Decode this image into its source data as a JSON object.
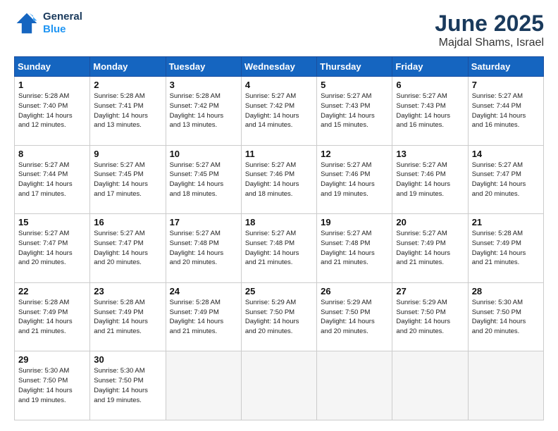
{
  "header": {
    "logo_line1": "General",
    "logo_line2": "Blue",
    "month": "June 2025",
    "location": "Majdal Shams, Israel"
  },
  "weekdays": [
    "Sunday",
    "Monday",
    "Tuesday",
    "Wednesday",
    "Thursday",
    "Friday",
    "Saturday"
  ],
  "weeks": [
    [
      {
        "day": "1",
        "info": "Sunrise: 5:28 AM\nSunset: 7:40 PM\nDaylight: 14 hours\nand 12 minutes."
      },
      {
        "day": "2",
        "info": "Sunrise: 5:28 AM\nSunset: 7:41 PM\nDaylight: 14 hours\nand 13 minutes."
      },
      {
        "day": "3",
        "info": "Sunrise: 5:28 AM\nSunset: 7:42 PM\nDaylight: 14 hours\nand 13 minutes."
      },
      {
        "day": "4",
        "info": "Sunrise: 5:27 AM\nSunset: 7:42 PM\nDaylight: 14 hours\nand 14 minutes."
      },
      {
        "day": "5",
        "info": "Sunrise: 5:27 AM\nSunset: 7:43 PM\nDaylight: 14 hours\nand 15 minutes."
      },
      {
        "day": "6",
        "info": "Sunrise: 5:27 AM\nSunset: 7:43 PM\nDaylight: 14 hours\nand 16 minutes."
      },
      {
        "day": "7",
        "info": "Sunrise: 5:27 AM\nSunset: 7:44 PM\nDaylight: 14 hours\nand 16 minutes."
      }
    ],
    [
      {
        "day": "8",
        "info": "Sunrise: 5:27 AM\nSunset: 7:44 PM\nDaylight: 14 hours\nand 17 minutes."
      },
      {
        "day": "9",
        "info": "Sunrise: 5:27 AM\nSunset: 7:45 PM\nDaylight: 14 hours\nand 17 minutes."
      },
      {
        "day": "10",
        "info": "Sunrise: 5:27 AM\nSunset: 7:45 PM\nDaylight: 14 hours\nand 18 minutes."
      },
      {
        "day": "11",
        "info": "Sunrise: 5:27 AM\nSunset: 7:46 PM\nDaylight: 14 hours\nand 18 minutes."
      },
      {
        "day": "12",
        "info": "Sunrise: 5:27 AM\nSunset: 7:46 PM\nDaylight: 14 hours\nand 19 minutes."
      },
      {
        "day": "13",
        "info": "Sunrise: 5:27 AM\nSunset: 7:46 PM\nDaylight: 14 hours\nand 19 minutes."
      },
      {
        "day": "14",
        "info": "Sunrise: 5:27 AM\nSunset: 7:47 PM\nDaylight: 14 hours\nand 20 minutes."
      }
    ],
    [
      {
        "day": "15",
        "info": "Sunrise: 5:27 AM\nSunset: 7:47 PM\nDaylight: 14 hours\nand 20 minutes."
      },
      {
        "day": "16",
        "info": "Sunrise: 5:27 AM\nSunset: 7:47 PM\nDaylight: 14 hours\nand 20 minutes."
      },
      {
        "day": "17",
        "info": "Sunrise: 5:27 AM\nSunset: 7:48 PM\nDaylight: 14 hours\nand 20 minutes."
      },
      {
        "day": "18",
        "info": "Sunrise: 5:27 AM\nSunset: 7:48 PM\nDaylight: 14 hours\nand 21 minutes."
      },
      {
        "day": "19",
        "info": "Sunrise: 5:27 AM\nSunset: 7:48 PM\nDaylight: 14 hours\nand 21 minutes."
      },
      {
        "day": "20",
        "info": "Sunrise: 5:27 AM\nSunset: 7:49 PM\nDaylight: 14 hours\nand 21 minutes."
      },
      {
        "day": "21",
        "info": "Sunrise: 5:28 AM\nSunset: 7:49 PM\nDaylight: 14 hours\nand 21 minutes."
      }
    ],
    [
      {
        "day": "22",
        "info": "Sunrise: 5:28 AM\nSunset: 7:49 PM\nDaylight: 14 hours\nand 21 minutes."
      },
      {
        "day": "23",
        "info": "Sunrise: 5:28 AM\nSunset: 7:49 PM\nDaylight: 14 hours\nand 21 minutes."
      },
      {
        "day": "24",
        "info": "Sunrise: 5:28 AM\nSunset: 7:49 PM\nDaylight: 14 hours\nand 21 minutes."
      },
      {
        "day": "25",
        "info": "Sunrise: 5:29 AM\nSunset: 7:50 PM\nDaylight: 14 hours\nand 20 minutes."
      },
      {
        "day": "26",
        "info": "Sunrise: 5:29 AM\nSunset: 7:50 PM\nDaylight: 14 hours\nand 20 minutes."
      },
      {
        "day": "27",
        "info": "Sunrise: 5:29 AM\nSunset: 7:50 PM\nDaylight: 14 hours\nand 20 minutes."
      },
      {
        "day": "28",
        "info": "Sunrise: 5:30 AM\nSunset: 7:50 PM\nDaylight: 14 hours\nand 20 minutes."
      }
    ],
    [
      {
        "day": "29",
        "info": "Sunrise: 5:30 AM\nSunset: 7:50 PM\nDaylight: 14 hours\nand 19 minutes."
      },
      {
        "day": "30",
        "info": "Sunrise: 5:30 AM\nSunset: 7:50 PM\nDaylight: 14 hours\nand 19 minutes."
      },
      {
        "day": "",
        "info": ""
      },
      {
        "day": "",
        "info": ""
      },
      {
        "day": "",
        "info": ""
      },
      {
        "day": "",
        "info": ""
      },
      {
        "day": "",
        "info": ""
      }
    ]
  ]
}
